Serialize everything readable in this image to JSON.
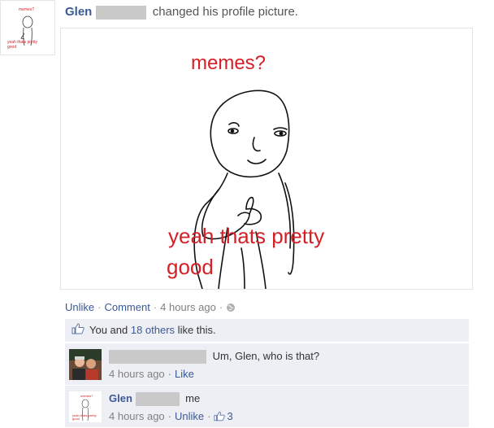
{
  "story": {
    "actor": "Glen",
    "verb": "changed his profile picture."
  },
  "photo": {
    "caption_top": "memes?",
    "caption_bottom_1": "yeah thats pretty",
    "caption_bottom_2": "good"
  },
  "actions": {
    "unlike": "Unlike",
    "dot": "·",
    "comment": "Comment",
    "time": "4 hours ago"
  },
  "likes": {
    "prefix": "You and ",
    "others": "18 others",
    "suffix": " like this."
  },
  "comments": [
    {
      "text": "Um, Glen, who is that?",
      "time": "4 hours ago",
      "dot": "·",
      "action": "Like"
    },
    {
      "author": "Glen",
      "text": "me",
      "time": "4 hours ago",
      "dot": "·",
      "action": "Unlike",
      "likes_count": "3"
    }
  ],
  "colors": {
    "link": "#3b5998",
    "ufi_background": "#edeff4",
    "meme_text": "#d42027"
  }
}
